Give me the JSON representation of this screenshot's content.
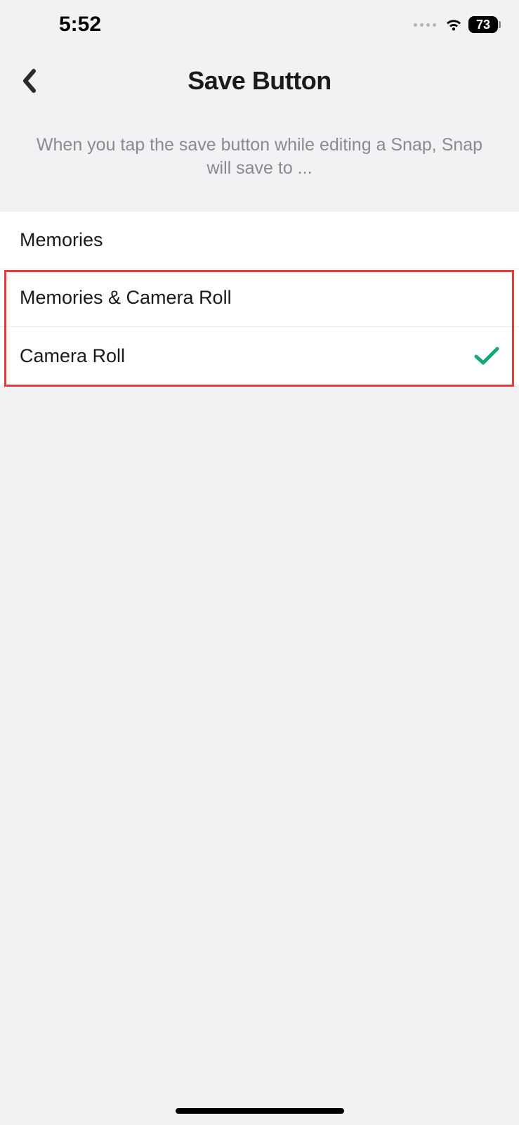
{
  "status": {
    "time": "5:52",
    "battery": "73"
  },
  "header": {
    "title": "Save Button"
  },
  "description": "When you tap the save button while editing a Snap, Snap will save to ...",
  "options": [
    {
      "label": "Memories",
      "selected": false
    },
    {
      "label": "Memories & Camera Roll",
      "selected": false
    },
    {
      "label": "Camera Roll",
      "selected": true
    }
  ]
}
